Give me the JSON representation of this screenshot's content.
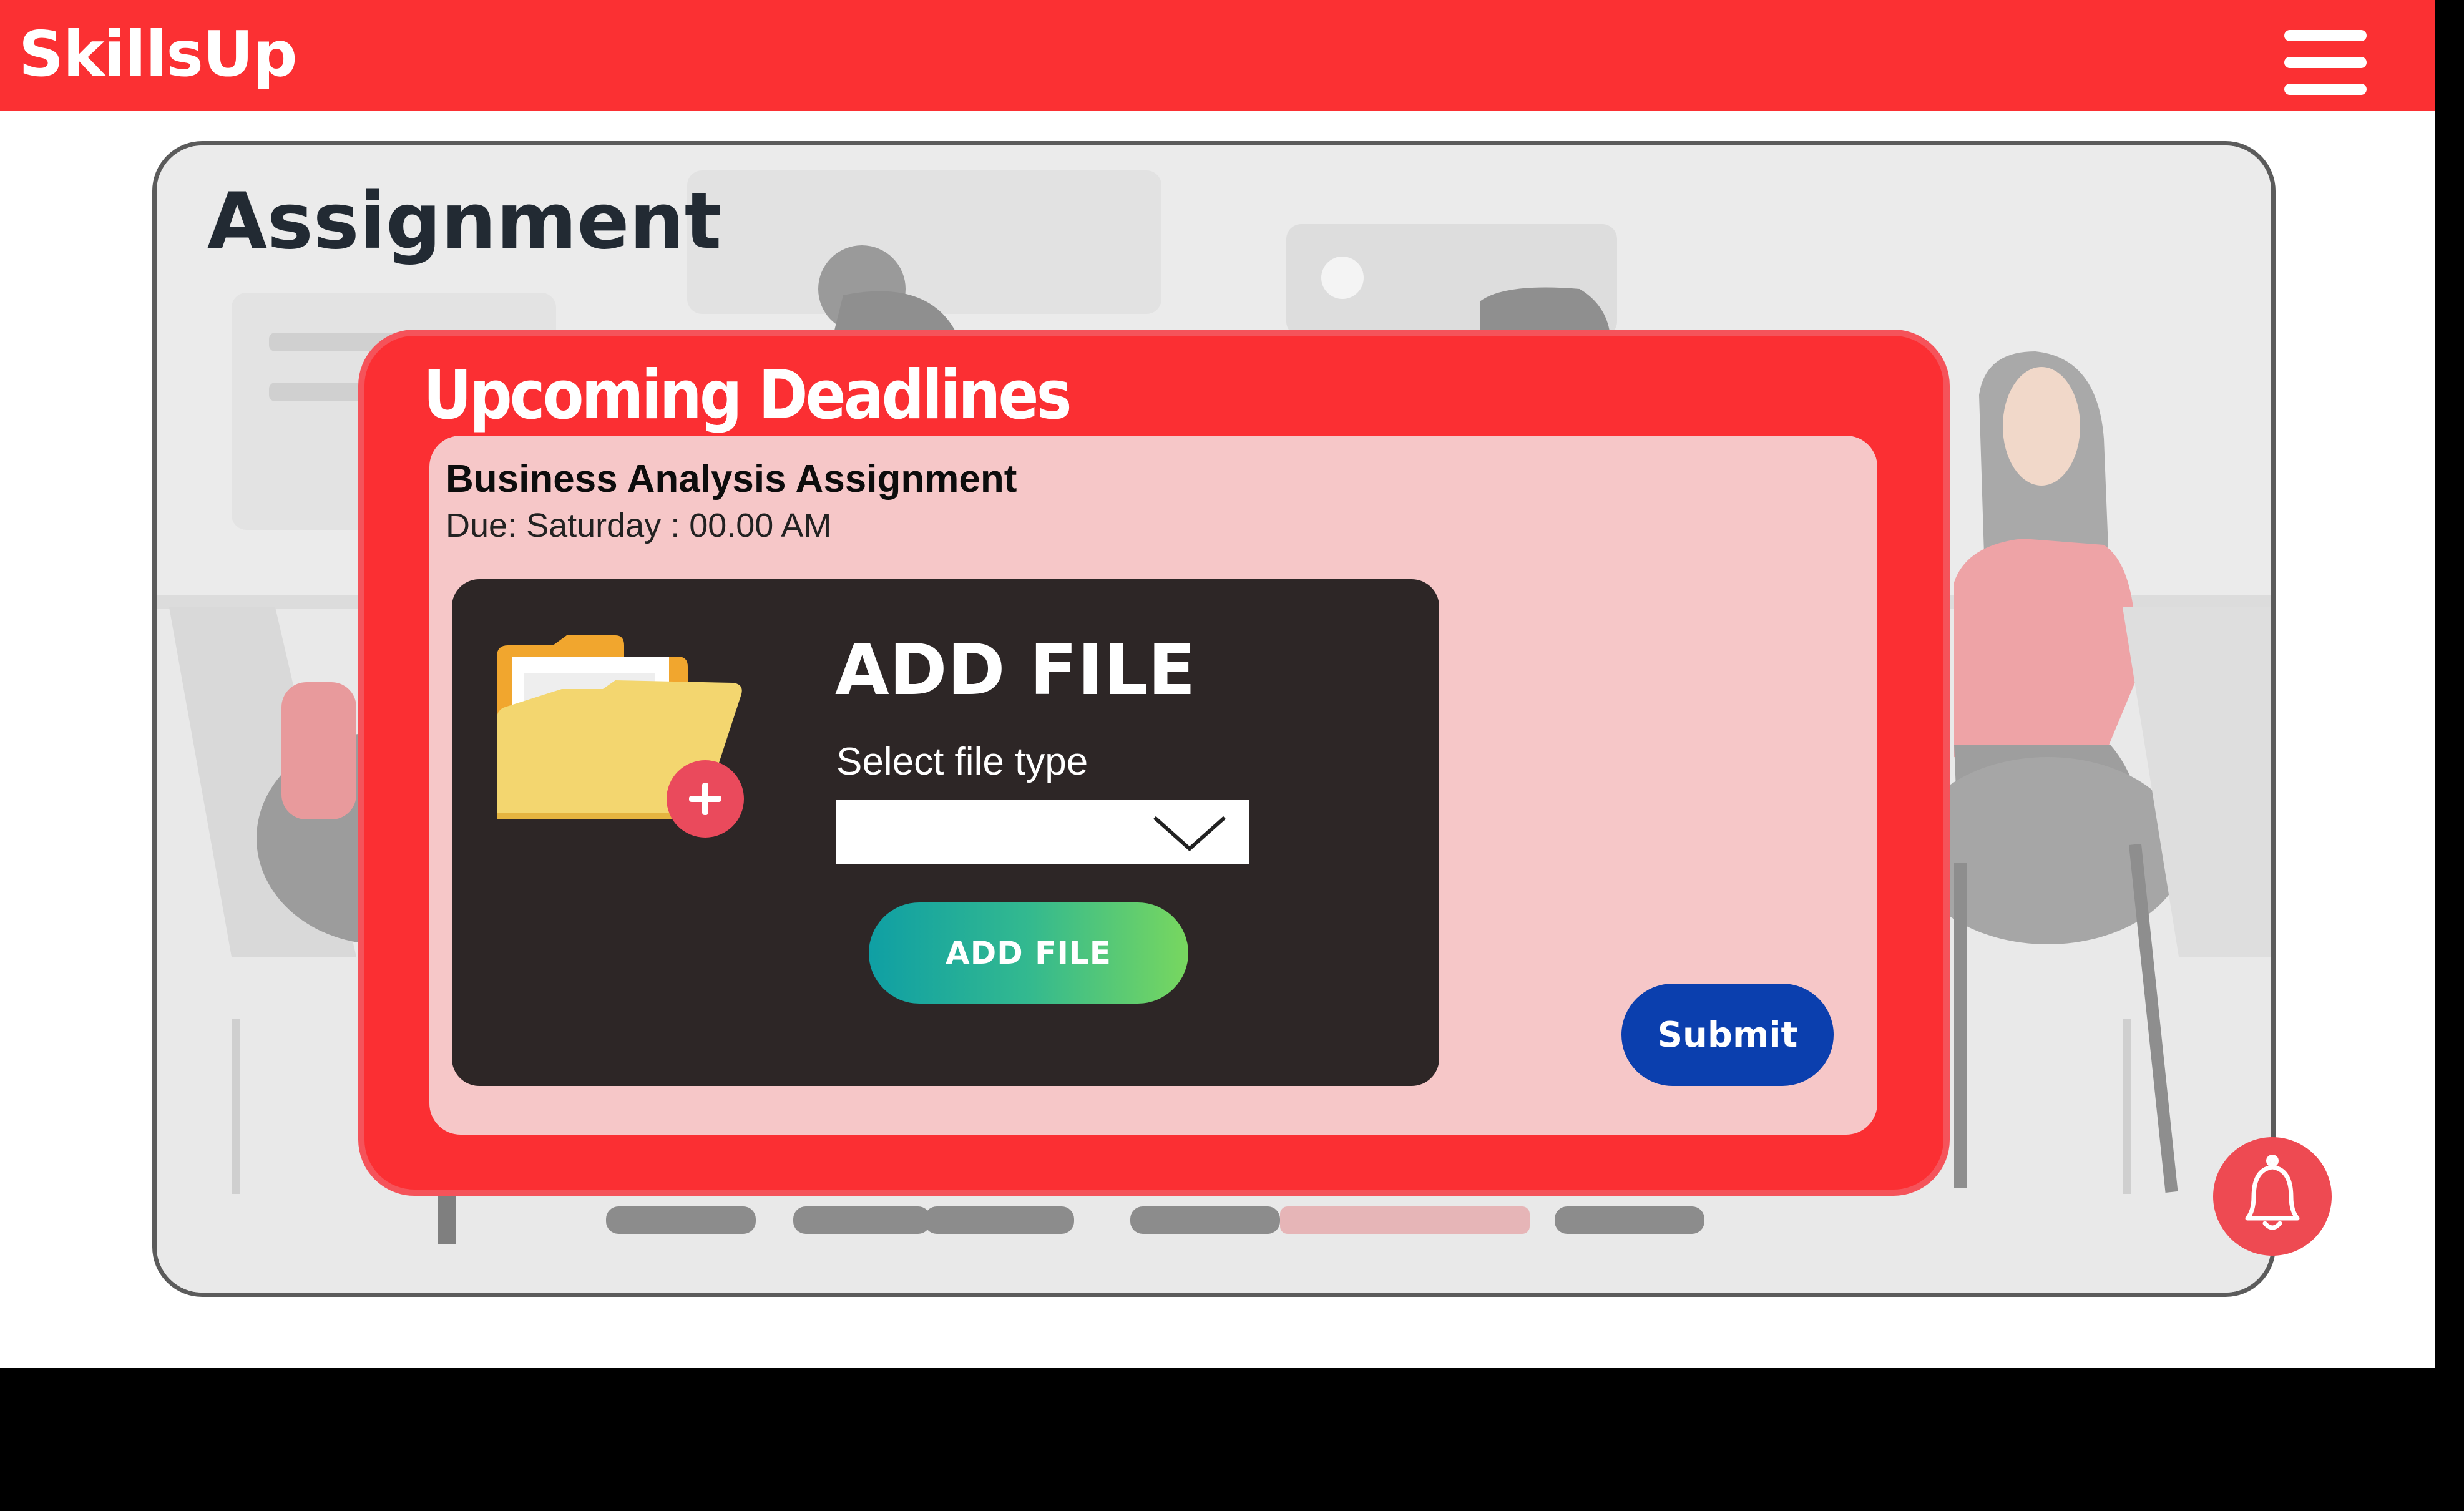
{
  "app": {
    "brand": "SkillsUp",
    "menu_icon": "hamburger-menu-icon"
  },
  "page": {
    "title": "Assignment"
  },
  "deadlines": {
    "heading": "Upcoming Deadlines",
    "assignment": {
      "name": "Business Analysis Assignment",
      "due": "Due: Saturday : 00.00 AM"
    }
  },
  "upload": {
    "heading": "ADD FILE",
    "file_type_label": "Select file type",
    "file_type_value": "",
    "add_button": "ADD FILE",
    "folder_icon": "folder-add-icon"
  },
  "actions": {
    "submit": "Submit",
    "notification_icon": "bell-icon"
  },
  "colors": {
    "topbar": "#fb3033",
    "panel": "#fb2f33",
    "card": "#f6c7c8",
    "upload_box": "#2d2626",
    "submit": "#0b3fae",
    "bell": "#ee4a52"
  }
}
